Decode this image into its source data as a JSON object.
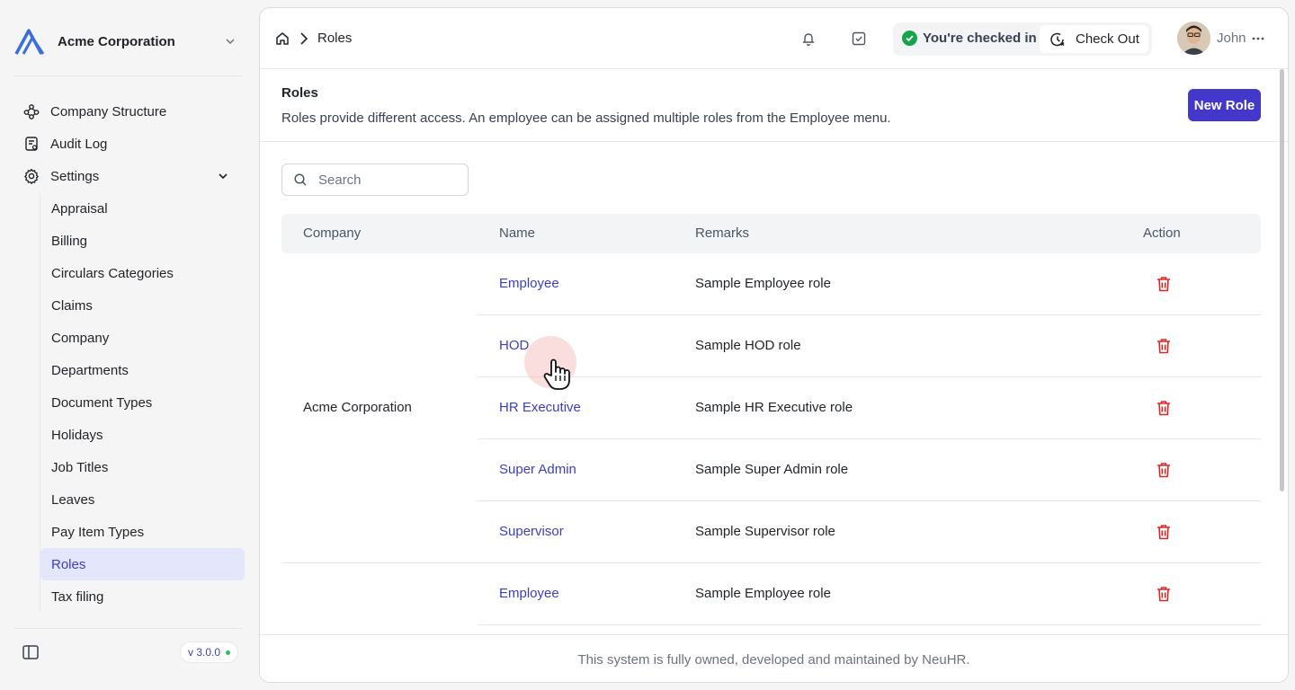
{
  "sidebar": {
    "org_name": "Acme Corporation",
    "nav": [
      {
        "label": "Company Structure",
        "icon": "org-chart-icon"
      },
      {
        "label": "Audit Log",
        "icon": "audit-log-icon"
      },
      {
        "label": "Settings",
        "icon": "gear-icon",
        "expanded": true
      }
    ],
    "settings_items": [
      "Appraisal",
      "Billing",
      "Circulars Categories",
      "Claims",
      "Company",
      "Departments",
      "Document Types",
      "Holidays",
      "Job Titles",
      "Leaves",
      "Pay Item Types",
      "Roles",
      "Tax filing"
    ],
    "active_item": "Roles",
    "version": "v 3.0.0"
  },
  "topbar": {
    "breadcrumb_current": "Roles",
    "checkin_status": "You're checked in",
    "checkout_label": "Check Out",
    "user_name": "John"
  },
  "page": {
    "title": "Roles",
    "description": "Roles provide different access. An employee can be assigned multiple roles from the Employee menu.",
    "new_button": "New Role",
    "search_placeholder": "Search"
  },
  "table": {
    "columns": [
      "Company",
      "Name",
      "Remarks",
      "Action"
    ],
    "company": "Acme Corporation",
    "rows": [
      {
        "name": "Employee",
        "remark": "Sample Employee role"
      },
      {
        "name": "HOD",
        "remark": "Sample HOD role"
      },
      {
        "name": "HR Executive",
        "remark": "Sample HR Executive role"
      },
      {
        "name": "Super Admin",
        "remark": "Sample Super Admin role"
      },
      {
        "name": "Supervisor",
        "remark": "Sample Supervisor role"
      },
      {
        "name": "Employee",
        "remark": "Sample Employee role"
      }
    ]
  },
  "footer": "This system is fully owned, developed and maintained by NeuHR.",
  "colors": {
    "accent": "#4338ca",
    "link": "#3b3fbf",
    "active_bg": "#e4e6fb",
    "danger": "#dc2626",
    "success": "#16a34a"
  }
}
